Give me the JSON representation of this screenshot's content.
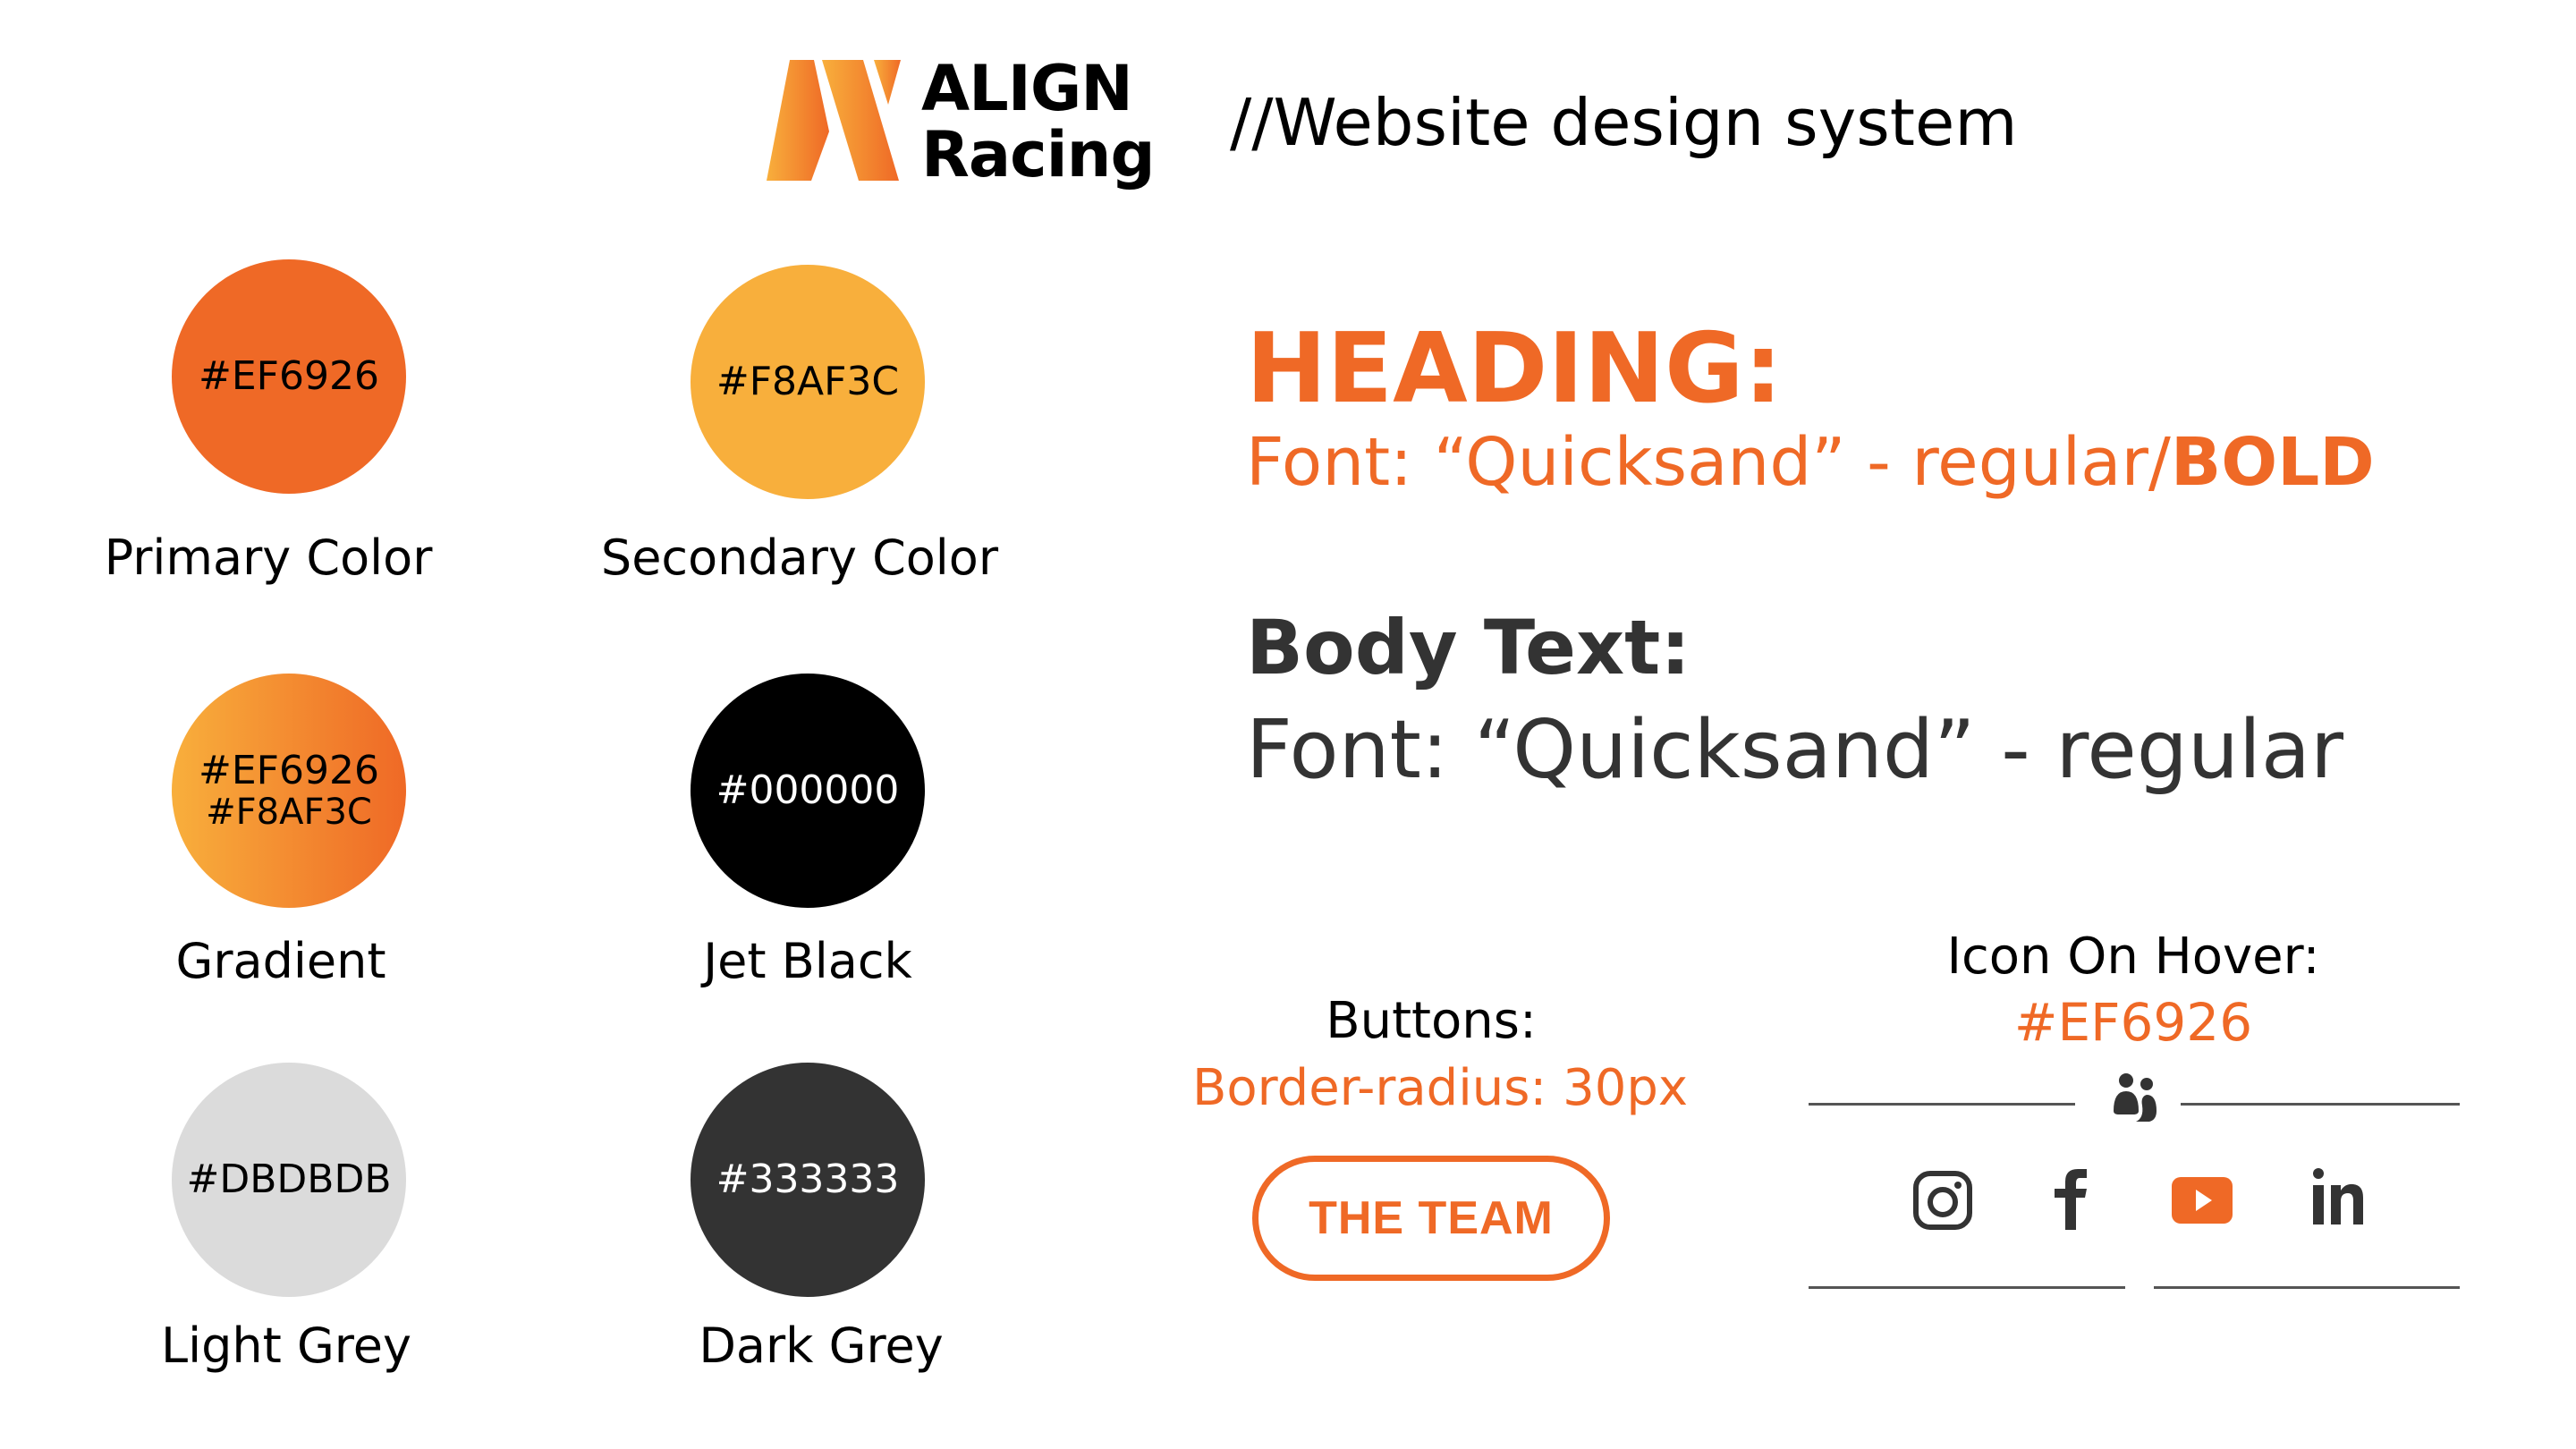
{
  "header": {
    "logo_line1": "ALIGN",
    "logo_line2": "Racing",
    "title": "//Website design system"
  },
  "swatches": [
    {
      "hex": "#EF6926",
      "label": "Primary Color",
      "color": "#EF6926"
    },
    {
      "hex": "#F8AF3C",
      "label": "Secondary Color",
      "color": "#F8AF3C"
    },
    {
      "hex": "#EF6926",
      "hex2": "#F8AF3C",
      "label": "Gradient",
      "gradient_from": "#F8AF3C",
      "gradient_to": "#EF6926"
    },
    {
      "hex": "#000000",
      "label": "Jet Black",
      "color": "#000000"
    },
    {
      "hex": "#DBDBDB",
      "label": "Light Grey",
      "color": "#DBDBDB"
    },
    {
      "hex": "#333333",
      "label": "Dark Grey",
      "color": "#333333"
    }
  ],
  "typography": {
    "heading_title": "HEADING:",
    "heading_desc_regular": "Font: “Quicksand” - regular/",
    "heading_desc_bold": "BOLD",
    "body_title": "Body Text:",
    "body_desc": "Font: “Quicksand” - regular"
  },
  "buttons": {
    "label": "Buttons:",
    "sublabel": "Border-radius: 30px",
    "sample_button": "THE TEAM"
  },
  "icons": {
    "label": "Icon On Hover:",
    "hover_color": "#EF6926",
    "team_icon": "people-icon",
    "social": [
      "instagram-icon",
      "facebook-icon",
      "youtube-icon",
      "linkedin-icon"
    ],
    "active": "youtube-icon"
  },
  "colors": {
    "primary": "#EF6926",
    "secondary": "#F8AF3C",
    "dark_grey": "#333333"
  }
}
